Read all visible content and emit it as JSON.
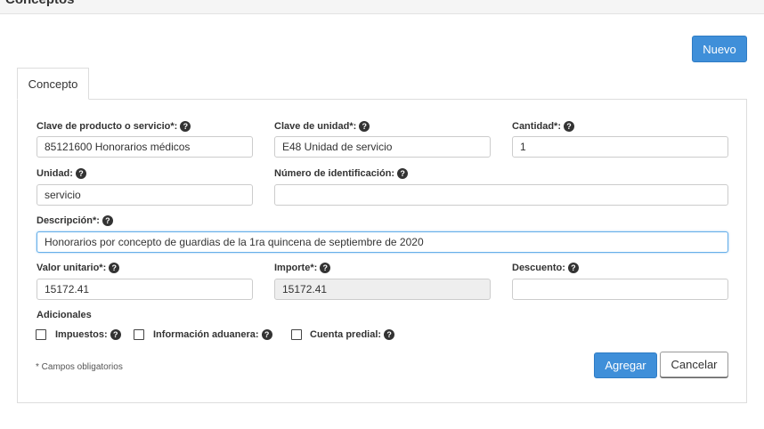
{
  "header": {
    "title": "Conceptos"
  },
  "toolbar": {
    "new_label": "Nuevo"
  },
  "tabs": [
    {
      "label": "Concepto"
    }
  ],
  "form": {
    "product_code": {
      "label": "Clave de producto o servicio*:",
      "value": "85121600 Honorarios médicos"
    },
    "unit_code": {
      "label": "Clave de unidad*:",
      "value": "E48 Unidad de servicio"
    },
    "quantity": {
      "label": "Cantidad*:",
      "value": "1"
    },
    "unit": {
      "label": "Unidad:",
      "value": "servicio"
    },
    "id_number": {
      "label": "Número de identificación:",
      "value": ""
    },
    "description": {
      "label": "Descripción*:",
      "value": "Honorarios por concepto de guardias de la 1ra quincena de septiembre de 2020"
    },
    "unit_value": {
      "label": "Valor unitario*:",
      "value": "15172.41"
    },
    "amount": {
      "label": "Importe*:",
      "value": "15172.41"
    },
    "discount": {
      "label": "Descuento:",
      "value": ""
    },
    "additional": {
      "label": "Adicionales",
      "options": [
        {
          "label": "Impuestos:",
          "checked": false
        },
        {
          "label": "Información aduanera:",
          "checked": false
        },
        {
          "label": "Cuenta predial:",
          "checked": false
        }
      ]
    },
    "required_note": "* Campos obligatorios",
    "add_label": "Agregar",
    "cancel_label": "Cancelar"
  },
  "icons": {
    "help": "question-circle-icon"
  },
  "colors": {
    "primary": "#3f8fd9",
    "focus_border": "#66afe9"
  }
}
